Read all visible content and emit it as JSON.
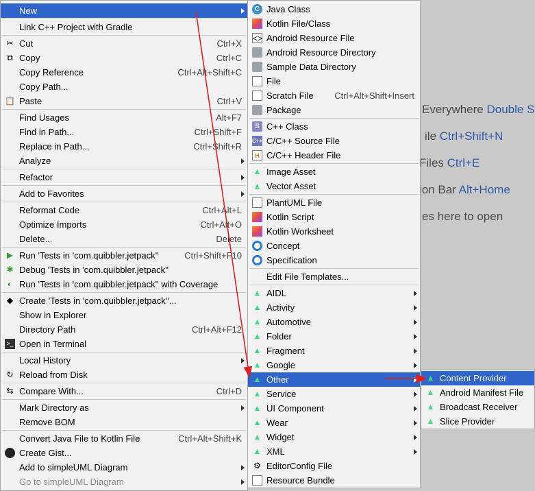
{
  "background_hints": [
    {
      "text": "Everywhere ",
      "key": "Double Sh"
    },
    {
      "text": "ile ",
      "key": "Ctrl+Shift+N"
    },
    {
      "text": " Files ",
      "key": "Ctrl+E"
    },
    {
      "text": "ion Bar ",
      "key": "Alt+Home"
    },
    {
      "text": "es here to open",
      "key": ""
    }
  ],
  "context_menu": {
    "items": [
      {
        "label": "New",
        "shortcut": "",
        "submenu": true,
        "selected": true,
        "icon": ""
      },
      {
        "label": "Link C++ Project with Gradle",
        "shortcut": "",
        "icon": ""
      },
      {
        "label": "Cut",
        "shortcut": "Ctrl+X",
        "icon": "scissors-icon"
      },
      {
        "label": "Copy",
        "shortcut": "Ctrl+C",
        "icon": "copy-icon"
      },
      {
        "label": "Copy Reference",
        "shortcut": "Ctrl+Alt+Shift+C",
        "icon": ""
      },
      {
        "label": "Copy Path...",
        "shortcut": "",
        "icon": ""
      },
      {
        "label": "Paste",
        "shortcut": "Ctrl+V",
        "icon": "paste-icon"
      },
      {
        "label": "Find Usages",
        "shortcut": "Alt+F7",
        "icon": ""
      },
      {
        "label": "Find in Path...",
        "shortcut": "Ctrl+Shift+F",
        "icon": ""
      },
      {
        "label": "Replace in Path...",
        "shortcut": "Ctrl+Shift+R",
        "icon": ""
      },
      {
        "label": "Analyze",
        "shortcut": "",
        "submenu": true,
        "icon": ""
      },
      {
        "label": "Refactor",
        "shortcut": "",
        "submenu": true,
        "icon": ""
      },
      {
        "label": "Add to Favorites",
        "shortcut": "",
        "submenu": true,
        "icon": ""
      },
      {
        "label": "Reformat Code",
        "shortcut": "Ctrl+Alt+L",
        "icon": ""
      },
      {
        "label": "Optimize Imports",
        "shortcut": "Ctrl+Alt+O",
        "icon": ""
      },
      {
        "label": "Delete...",
        "shortcut": "Delete",
        "icon": ""
      },
      {
        "label": "Run 'Tests in 'com.quibbler.jetpack''",
        "shortcut": "Ctrl+Shift+F10",
        "icon": "run-icon"
      },
      {
        "label": "Debug 'Tests in 'com.quibbler.jetpack''",
        "shortcut": "",
        "icon": "debug-icon"
      },
      {
        "label": "Run 'Tests in 'com.quibbler.jetpack'' with Coverage",
        "shortcut": "",
        "icon": "coverage-icon"
      },
      {
        "label": "Create 'Tests in 'com.quibbler.jetpack''...",
        "shortcut": "",
        "icon": "create-test-icon"
      },
      {
        "label": "Show in Explorer",
        "shortcut": "",
        "icon": ""
      },
      {
        "label": "Directory Path",
        "shortcut": "Ctrl+Alt+F12",
        "icon": ""
      },
      {
        "label": "Open in Terminal",
        "shortcut": "",
        "icon": "terminal-icon"
      },
      {
        "label": "Local History",
        "shortcut": "",
        "submenu": true,
        "icon": ""
      },
      {
        "label": "Reload from Disk",
        "shortcut": "",
        "icon": "reload-icon"
      },
      {
        "label": "Compare With...",
        "shortcut": "Ctrl+D",
        "icon": "compare-icon"
      },
      {
        "label": "Mark Directory as",
        "shortcut": "",
        "submenu": true,
        "icon": ""
      },
      {
        "label": "Remove BOM",
        "shortcut": "",
        "icon": ""
      },
      {
        "label": "Convert Java File to Kotlin File",
        "shortcut": "Ctrl+Alt+Shift+K",
        "icon": ""
      },
      {
        "label": "Create Gist...",
        "shortcut": "",
        "icon": "github-icon"
      },
      {
        "label": "Add to simpleUML Diagram",
        "shortcut": "",
        "submenu": true,
        "icon": ""
      },
      {
        "label": "Go to simpleUML Diagram",
        "shortcut": "",
        "submenu": true,
        "disabled": true,
        "icon": ""
      }
    ]
  },
  "new_submenu": {
    "items": [
      {
        "label": "Java Class",
        "shortcut": "",
        "icon": "java-class-icon"
      },
      {
        "label": "Kotlin File/Class",
        "shortcut": "",
        "icon": "kotlin-icon"
      },
      {
        "label": "Android Resource File",
        "shortcut": "",
        "icon": "resource-file-icon"
      },
      {
        "label": "Android Resource Directory",
        "shortcut": "",
        "icon": "folder-icon"
      },
      {
        "label": "Sample Data Directory",
        "shortcut": "",
        "icon": "folder-icon"
      },
      {
        "label": "File",
        "shortcut": "",
        "icon": "file-icon"
      },
      {
        "label": "Scratch File",
        "shortcut": "Ctrl+Alt+Shift+Insert",
        "icon": "scratch-file-icon"
      },
      {
        "label": "Package",
        "shortcut": "",
        "icon": "package-icon"
      },
      {
        "label": "C++ Class",
        "shortcut": "",
        "icon": "cpp-class-icon"
      },
      {
        "label": "C/C++ Source File",
        "shortcut": "",
        "icon": "cpp-source-icon"
      },
      {
        "label": "C/C++ Header File",
        "shortcut": "",
        "icon": "cpp-header-icon"
      },
      {
        "label": "Image Asset",
        "shortcut": "",
        "icon": "android-icon"
      },
      {
        "label": "Vector Asset",
        "shortcut": "",
        "icon": "android-icon"
      },
      {
        "label": "PlantUML File",
        "shortcut": "",
        "icon": "plantuml-icon"
      },
      {
        "label": "Kotlin Script",
        "shortcut": "",
        "icon": "kotlin-script-icon"
      },
      {
        "label": "Kotlin Worksheet",
        "shortcut": "",
        "icon": "kotlin-worksheet-icon"
      },
      {
        "label": "Concept",
        "shortcut": "",
        "icon": "concept-icon"
      },
      {
        "label": "Specification",
        "shortcut": "",
        "icon": "specification-icon"
      },
      {
        "label": "Edit File Templates...",
        "shortcut": "",
        "icon": ""
      },
      {
        "label": "AIDL",
        "shortcut": "",
        "submenu": true,
        "icon": "android-icon"
      },
      {
        "label": "Activity",
        "shortcut": "",
        "submenu": true,
        "icon": "android-icon"
      },
      {
        "label": "Automotive",
        "shortcut": "",
        "submenu": true,
        "icon": "android-icon"
      },
      {
        "label": "Folder",
        "shortcut": "",
        "submenu": true,
        "icon": "android-icon"
      },
      {
        "label": "Fragment",
        "shortcut": "",
        "submenu": true,
        "icon": "android-icon"
      },
      {
        "label": "Google",
        "shortcut": "",
        "submenu": true,
        "icon": "android-icon"
      },
      {
        "label": "Other",
        "shortcut": "",
        "submenu": true,
        "selected": true,
        "icon": "android-icon"
      },
      {
        "label": "Service",
        "shortcut": "",
        "submenu": true,
        "icon": "android-icon"
      },
      {
        "label": "UI Component",
        "shortcut": "",
        "submenu": true,
        "icon": "android-icon"
      },
      {
        "label": "Wear",
        "shortcut": "",
        "submenu": true,
        "icon": "android-icon"
      },
      {
        "label": "Widget",
        "shortcut": "",
        "submenu": true,
        "icon": "android-icon"
      },
      {
        "label": "XML",
        "shortcut": "",
        "submenu": true,
        "icon": "android-icon"
      },
      {
        "label": "EditorConfig File",
        "shortcut": "",
        "icon": "editorconfig-icon"
      },
      {
        "label": "Resource Bundle",
        "shortcut": "",
        "icon": "resource-bundle-icon"
      }
    ]
  },
  "other_submenu": {
    "items": [
      {
        "label": "Content Provider",
        "selected": true,
        "icon": "android-icon"
      },
      {
        "label": "Android Manifest File",
        "icon": "android-icon"
      },
      {
        "label": "Broadcast Receiver",
        "icon": "android-icon"
      },
      {
        "label": "Slice Provider",
        "icon": "android-icon"
      }
    ]
  },
  "colors": {
    "selection": "#2f65ca",
    "menu_background": "#f2f2f2",
    "annotation_arrow": "#e02020",
    "android_green": "#3ddc84"
  }
}
